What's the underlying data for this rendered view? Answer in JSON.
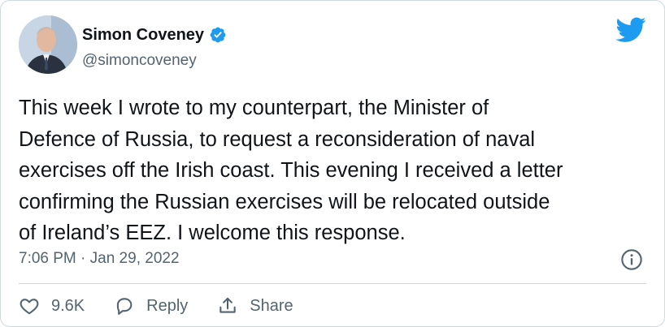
{
  "author": {
    "name": "Simon Coveney",
    "handle": "@simoncoveney",
    "verified": true
  },
  "tweet": {
    "text": "This week I wrote to my counterpart, the Minister of\nDefence of Russia, to request a reconsideration of naval\nexercises off the Irish coast. This evening I received a letter\nconfirming the Russian exercises will be relocated outside\nof Ireland’s EEZ. I welcome this response.",
    "timestamp": "7:06 PM · Jan 29, 2022"
  },
  "actions": {
    "like_count": "9.6K",
    "reply_label": "Reply",
    "share_label": "Share"
  },
  "icons": {
    "brand": "twitter-bird-icon",
    "verified": "verified-badge-icon",
    "info": "info-icon",
    "like": "heart-icon",
    "reply": "reply-bubble-icon",
    "share": "share-icon"
  },
  "colors": {
    "brand_blue": "#1d9bf0",
    "text_primary": "#0f1419",
    "text_secondary": "#536471",
    "border": "#cfd9de"
  }
}
